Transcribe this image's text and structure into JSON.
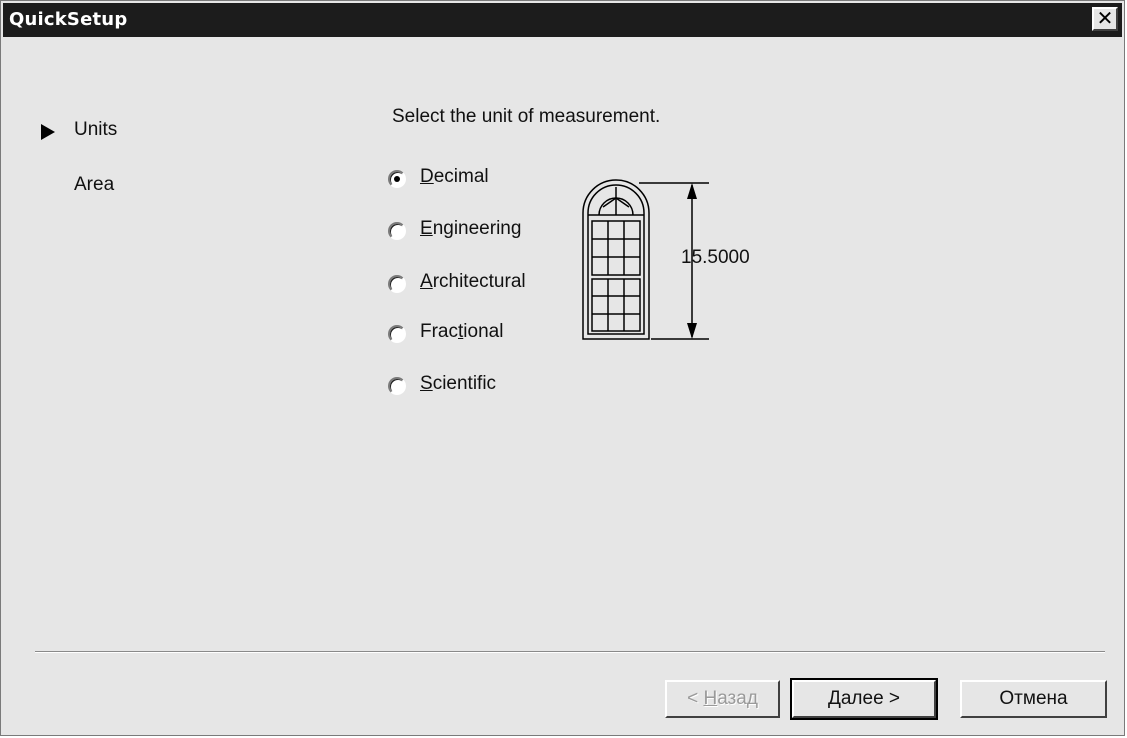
{
  "window": {
    "title": "QuickSetup",
    "close_glyph": "✕"
  },
  "nav": {
    "items": [
      {
        "label": "Units",
        "active": true
      },
      {
        "label": "Area",
        "active": false
      }
    ]
  },
  "main": {
    "prompt": "Select the unit of measurement.",
    "options": [
      {
        "pre": "",
        "key": "D",
        "post": "ecimal",
        "checked": true
      },
      {
        "pre": "",
        "key": "E",
        "post": "ngineering",
        "checked": false
      },
      {
        "pre": "",
        "key": "A",
        "post": "rchitectural",
        "checked": false
      },
      {
        "pre": "Frac",
        "key": "t",
        "post": "ional",
        "checked": false
      },
      {
        "pre": "",
        "key": "S",
        "post": "cientific",
        "checked": false
      }
    ],
    "preview_value": "15.5000"
  },
  "buttons": {
    "back": {
      "pre": "< ",
      "key": "Н",
      "post": "азад",
      "enabled": false
    },
    "next": {
      "pre": "",
      "key": "Д",
      "post": "алее >",
      "enabled": true
    },
    "cancel": {
      "label": "Отмена",
      "enabled": true
    }
  },
  "colors": {
    "titlebar": "#1c1c1c",
    "face": "#e6e6e6",
    "disabled_text": "#9a9a9a"
  }
}
